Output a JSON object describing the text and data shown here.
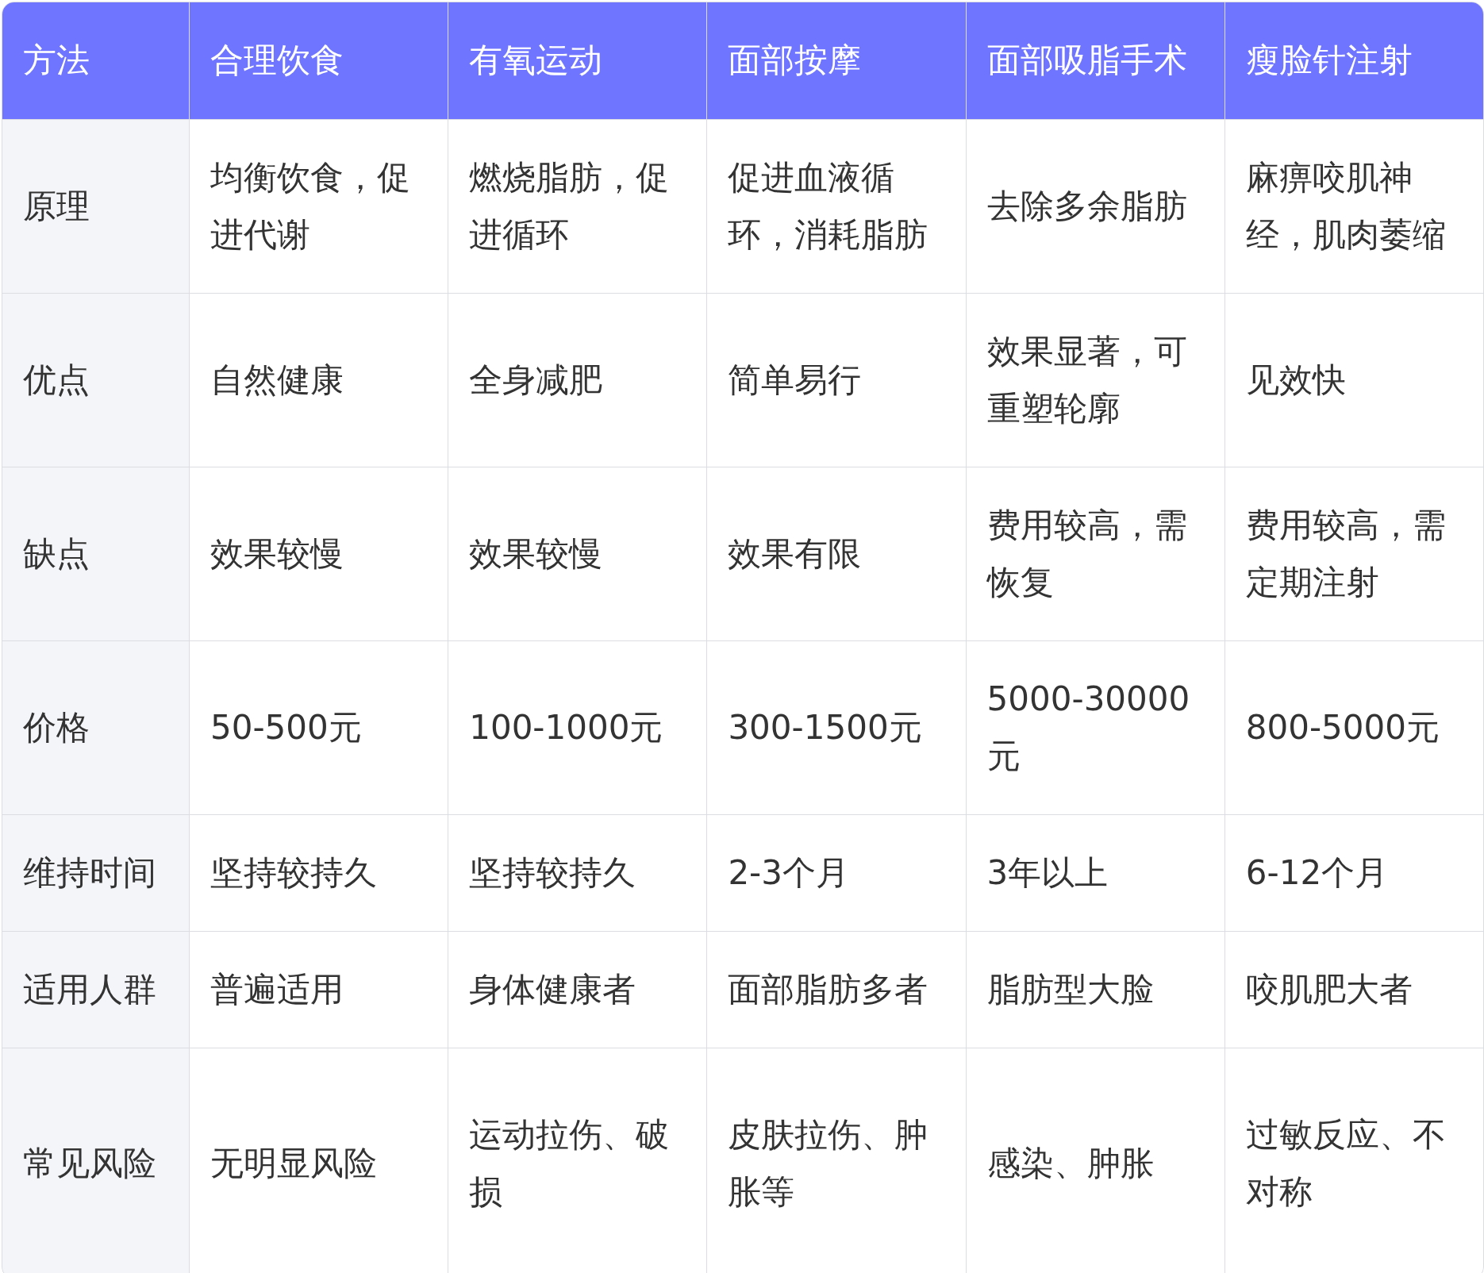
{
  "table": {
    "columns": [
      "方法",
      "合理饮食",
      "有氧运动",
      "面部按摩",
      "面部吸脂手术",
      "瘦脸针注射"
    ],
    "rows": [
      {
        "cells": [
          "原理",
          "均衡饮食，促进代谢",
          "燃烧脂肪，促进循环",
          "促进血液循环，消耗脂肪",
          "去除多余脂肪",
          "麻痹咬肌神经，肌肉萎缩"
        ]
      },
      {
        "cells": [
          "优点",
          "自然健康",
          "全身减肥",
          "简单易行",
          "效果显著，可重塑轮廓",
          "见效快"
        ]
      },
      {
        "cells": [
          "缺点",
          "效果较慢",
          "效果较慢",
          "效果有限",
          "费用较高，需恢复",
          "费用较高，需定期注射"
        ]
      },
      {
        "cells": [
          "价格",
          "50-500元",
          "100-1000元",
          "300-1500元",
          "5000-30000元",
          "800-5000元"
        ]
      },
      {
        "cells": [
          "维持时间",
          "坚持较持久",
          "坚持较持久",
          "2-3个月",
          "3年以上",
          "6-12个月"
        ]
      },
      {
        "cells": [
          "适用人群",
          "普遍适用",
          "身体健康者",
          "面部脂肪多者",
          "脂肪型大脸",
          "咬肌肥大者"
        ]
      },
      {
        "cells": [
          "常见风险",
          "无明显风险",
          "运动拉伤、破损",
          "皮肤拉伤、肿胀等",
          "感染、肿胀",
          "过敏反应、不对称"
        ]
      }
    ]
  }
}
